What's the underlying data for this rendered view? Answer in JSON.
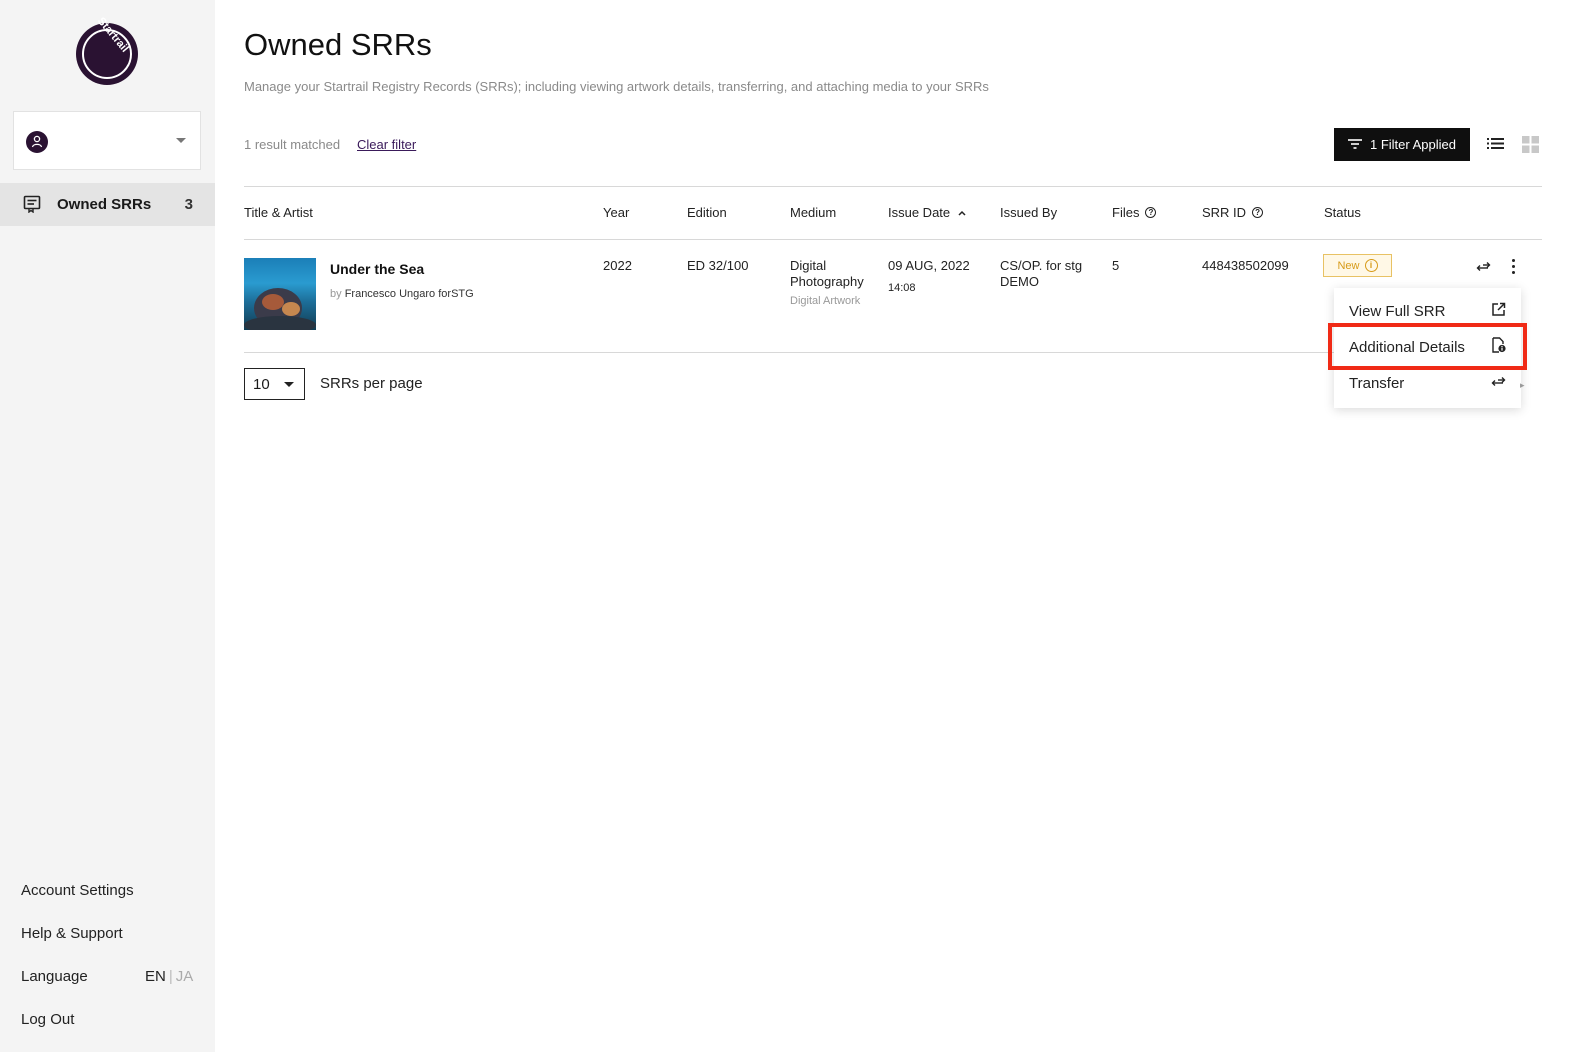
{
  "sidebar": {
    "logo_text": "Startrail",
    "nav": {
      "label": "Owned SRRs",
      "count": "3"
    },
    "links": {
      "account_settings": "Account Settings",
      "help_support": "Help & Support",
      "language": "Language",
      "log_out": "Log Out"
    },
    "language_options": {
      "en": "EN",
      "separator": "|",
      "ja": "JA"
    }
  },
  "header": {
    "title": "Owned SRRs",
    "subtitle": "Manage your Startrail Registry Records (SRRs); including viewing artwork details, transferring, and attaching media to your SRRs"
  },
  "filter_bar": {
    "result_text": "1 result matched",
    "clear_filter": "Clear filter",
    "filter_button": "1 Filter Applied"
  },
  "table": {
    "columns": {
      "title_artist": "Title & Artist",
      "year": "Year",
      "edition": "Edition",
      "medium": "Medium",
      "issue_date": "Issue Date",
      "issued_by": "Issued By",
      "files": "Files",
      "srr_id": "SRR ID",
      "status": "Status"
    },
    "rows": [
      {
        "title": "Under the Sea",
        "by_prefix": "by",
        "artist": "Francesco Ungaro forSTG",
        "year": "2022",
        "edition": "ED 32/100",
        "medium_line1": "Digital",
        "medium_line2": "Photography",
        "medium_type": "Digital Artwork",
        "issue_date": "09 AUG, 2022",
        "issue_time": "14:08",
        "issued_by_line1": "CS/OP. for stg",
        "issued_by_line2": "DEMO",
        "files": "5",
        "srr_id": "448438502099",
        "status": "New"
      }
    ]
  },
  "pagination": {
    "per_page_value": "10",
    "per_page_label": "SRRs per page"
  },
  "context_menu": {
    "items": [
      {
        "label": "View Full SRR",
        "icon": "external-link-icon"
      },
      {
        "label": "Additional Details",
        "icon": "document-info-icon"
      },
      {
        "label": "Transfer",
        "icon": "transfer-arrows-icon"
      }
    ]
  },
  "colors": {
    "brand": "#2a1232",
    "highlight": "#f02a16",
    "status_new": "#d79b1a"
  }
}
